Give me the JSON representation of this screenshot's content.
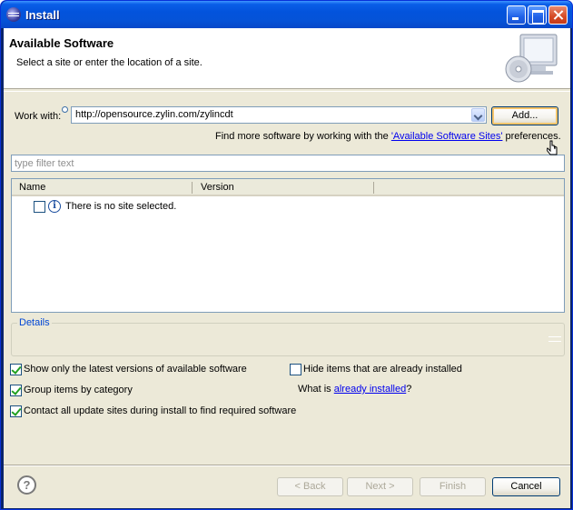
{
  "window": {
    "title": "Install"
  },
  "banner": {
    "title": "Available Software",
    "description": "Select a site or enter the location of a site."
  },
  "work_with": {
    "label": "Work with:",
    "value": "http://opensource.zylin.com/zylincdt",
    "add_label": "Add..."
  },
  "more_software": {
    "prefix": "Find more software by working with the ",
    "link": "'Available Software Sites'",
    "suffix": " preferences."
  },
  "filter": {
    "placeholder": "type filter text"
  },
  "table": {
    "columns": [
      "Name",
      "Version"
    ],
    "rows": [
      {
        "text": "There is no site selected.",
        "icon": "info-icon",
        "checked": false
      }
    ]
  },
  "details": {
    "title": "Details"
  },
  "options": {
    "latest": {
      "label": "Show only the latest versions of available software",
      "checked": true
    },
    "hide_installed": {
      "label": "Hide items that are already installed",
      "checked": false
    },
    "group": {
      "label": "Group items by category",
      "checked": true
    },
    "what_is_prefix": "What is ",
    "what_is_link": "already installed",
    "what_is_suffix": "?",
    "contact": {
      "label": "Contact all update sites during install to find required software",
      "checked": true
    }
  },
  "footer": {
    "back": "< Back",
    "next": "Next >",
    "finish": "Finish",
    "cancel": "Cancel",
    "help": "?"
  }
}
